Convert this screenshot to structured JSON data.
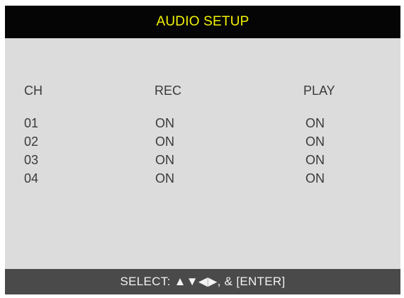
{
  "title": "AUDIO SETUP",
  "columns": {
    "ch": "CH",
    "rec": "REC",
    "play": "PLAY"
  },
  "rows": [
    {
      "ch": "01",
      "rec": "ON",
      "play": "ON"
    },
    {
      "ch": "02",
      "rec": "ON",
      "play": "ON"
    },
    {
      "ch": "03",
      "rec": "ON",
      "play": "ON"
    },
    {
      "ch": "04",
      "rec": "ON",
      "play": "ON"
    }
  ],
  "status": {
    "text": "SELECT: ▲▼◀▶, & [ENTER]"
  },
  "colors": {
    "title_bar": "#050505",
    "title_text": "#f2f200",
    "panel": "#dcdcdc",
    "status_bar": "#4a4a4a",
    "status_text": "#f2f2f2",
    "text": "#3a3a3a"
  }
}
